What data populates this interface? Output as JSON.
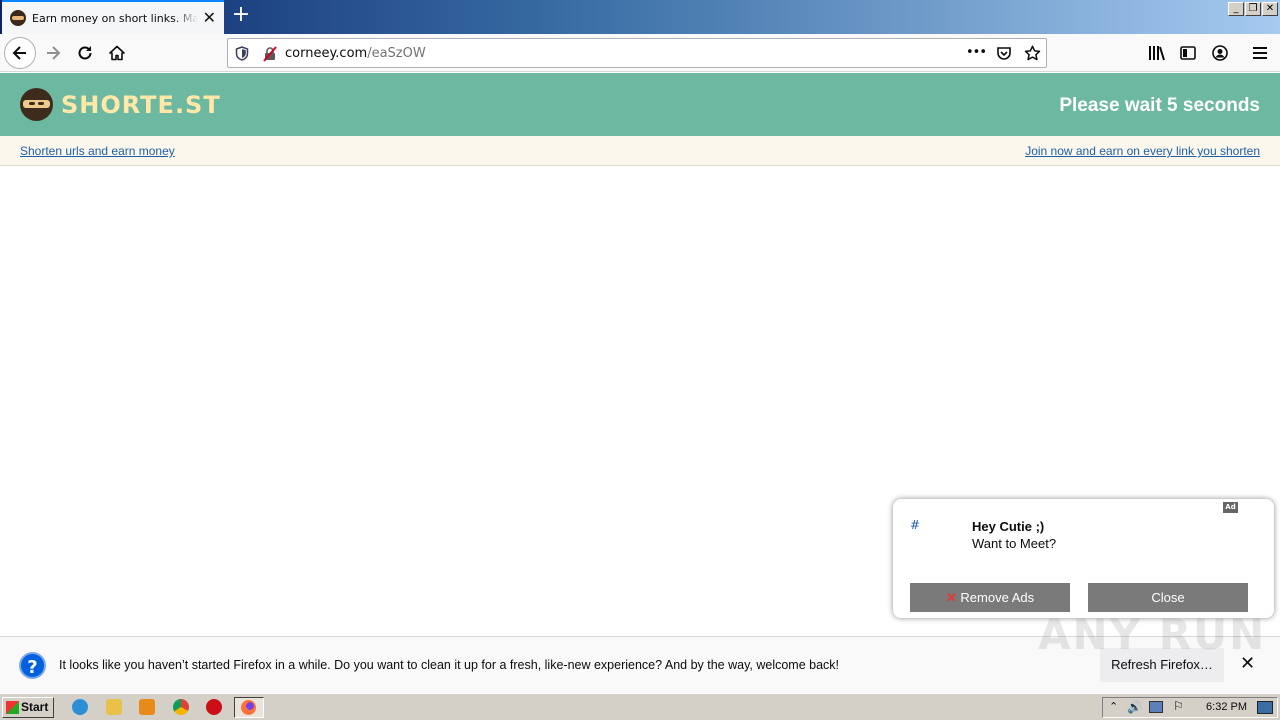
{
  "browser": {
    "tab_title": "Earn money on short links. Make sh",
    "new_tab_label": "+",
    "url_host": "corneey.com",
    "url_path": "/eaSzOW",
    "more_label": "•••"
  },
  "site": {
    "logo_text": "SHORTE.ST",
    "wait_text": "Please wait 5 seconds",
    "shorten_link": "Shorten urls and earn money",
    "join_link": "Join now and earn on every link you shorten"
  },
  "ad": {
    "badge": "Ad",
    "hash": "#",
    "title": "Hey Cutie ;)",
    "subtitle": "Want to Meet?",
    "remove_label": "Remove Ads",
    "close_label": "Close"
  },
  "notification": {
    "icon": "?",
    "message": "It looks like you haven’t started Firefox in a while. Do you want to clean it up for a fresh, like-new experience? And by the way, welcome back!",
    "refresh_label": "Refresh Firefox…",
    "close_label": "✕"
  },
  "watermark": "ANY RUN",
  "taskbar": {
    "start_label": "Start",
    "clock": "6:32 PM"
  },
  "colors": {
    "header_bg": "#6db8a0",
    "link": "#1f5fa8",
    "ad_button": "#7a7a7a",
    "accent": "#0060df"
  }
}
